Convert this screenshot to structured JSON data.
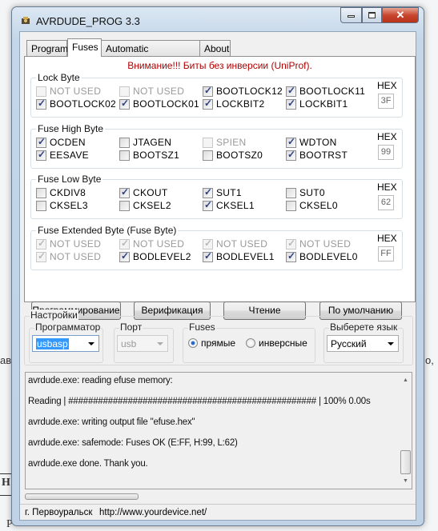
{
  "window": {
    "title": "AVRDUDE_PROG 3.3"
  },
  "background_fragments": [
    "ав",
    "о,",
    "Н",
    "Р"
  ],
  "tabs": [
    {
      "label": "Program"
    },
    {
      "label": "Fuses"
    },
    {
      "label": "Automatic programming"
    },
    {
      "label": "About"
    }
  ],
  "active_tab": "Fuses",
  "warning": "Внимание!!! Биты без инверсии (UniProf).",
  "hex_label": "HEX",
  "groups": [
    {
      "title": "Lock Byte",
      "hex": "3F",
      "bits": [
        {
          "label": "NOT USED",
          "checked": false,
          "disabled": true
        },
        {
          "label": "NOT USED",
          "checked": false,
          "disabled": true
        },
        {
          "label": "BOOTLOCK12",
          "checked": true,
          "disabled": false
        },
        {
          "label": "BOOTLOCK11",
          "checked": true,
          "disabled": false
        },
        {
          "label": "BOOTLOCK02",
          "checked": true,
          "disabled": false
        },
        {
          "label": "BOOTLOCK01",
          "checked": true,
          "disabled": false
        },
        {
          "label": "LOCKBIT2",
          "checked": true,
          "disabled": false
        },
        {
          "label": "LOCKBIT1",
          "checked": true,
          "disabled": false
        }
      ]
    },
    {
      "title": "Fuse High Byte",
      "hex": "99",
      "bits": [
        {
          "label": "OCDEN",
          "checked": true,
          "disabled": false
        },
        {
          "label": "JTAGEN",
          "checked": false,
          "disabled": false
        },
        {
          "label": "SPIEN",
          "checked": false,
          "disabled": true
        },
        {
          "label": "WDTON",
          "checked": true,
          "disabled": false
        },
        {
          "label": "EESAVE",
          "checked": true,
          "disabled": false
        },
        {
          "label": "BOOTSZ1",
          "checked": false,
          "disabled": false
        },
        {
          "label": "BOOTSZ0",
          "checked": false,
          "disabled": false
        },
        {
          "label": "BOOTRST",
          "checked": true,
          "disabled": false
        }
      ]
    },
    {
      "title": "Fuse Low Byte",
      "hex": "62",
      "bits": [
        {
          "label": "CKDIV8",
          "checked": false,
          "disabled": false
        },
        {
          "label": "CKOUT",
          "checked": true,
          "disabled": false
        },
        {
          "label": "SUT1",
          "checked": true,
          "disabled": false
        },
        {
          "label": "SUT0",
          "checked": false,
          "disabled": false
        },
        {
          "label": "CKSEL3",
          "checked": false,
          "disabled": false
        },
        {
          "label": "CKSEL2",
          "checked": false,
          "disabled": false
        },
        {
          "label": "CKSEL1",
          "checked": true,
          "disabled": false
        },
        {
          "label": "CKSEL0",
          "checked": false,
          "disabled": false
        }
      ]
    },
    {
      "title": "Fuse Extended Byte (Fuse Byte)",
      "hex": "FF",
      "bits": [
        {
          "label": "NOT USED",
          "checked": true,
          "disabled": true
        },
        {
          "label": "NOT USED",
          "checked": true,
          "disabled": true
        },
        {
          "label": "NOT USED",
          "checked": true,
          "disabled": true
        },
        {
          "label": "NOT USED",
          "checked": true,
          "disabled": true
        },
        {
          "label": "NOT USED",
          "checked": true,
          "disabled": true
        },
        {
          "label": "BODLEVEL2",
          "checked": true,
          "disabled": false
        },
        {
          "label": "BODLEVEL1",
          "checked": true,
          "disabled": false
        },
        {
          "label": "BODLEVEL0",
          "checked": true,
          "disabled": false
        }
      ]
    }
  ],
  "buttons": {
    "program": "Программирование",
    "verify": "Верификация",
    "read": "Чтение",
    "default": "По умолчанию"
  },
  "settings": {
    "title": "Настройки",
    "programmer": {
      "label": "Программатор",
      "value": "usbasp"
    },
    "port": {
      "label": "Порт",
      "value": "usb"
    },
    "fuses": {
      "label": "Fuses",
      "direct": "прямые",
      "inverse": "инверсные",
      "selected": "прямые"
    },
    "language": {
      "label": "Выберете язык",
      "value": "Русский"
    }
  },
  "log": [
    "avrdude.exe: reading efuse memory:",
    "Reading | ################################################## | 100% 0.00s",
    "avrdude.exe: writing output file \"efuse.hex\"",
    "avrdude.exe: safemode: Fuses OK (E:FF, H:99, L:62)",
    "avrdude.exe done.  Thank you."
  ],
  "status": {
    "city": "г. Первоуральск",
    "url": "http://www.yourdevice.net/"
  },
  "colors": {
    "warning": "#b00000",
    "selection": "#3399ff"
  }
}
